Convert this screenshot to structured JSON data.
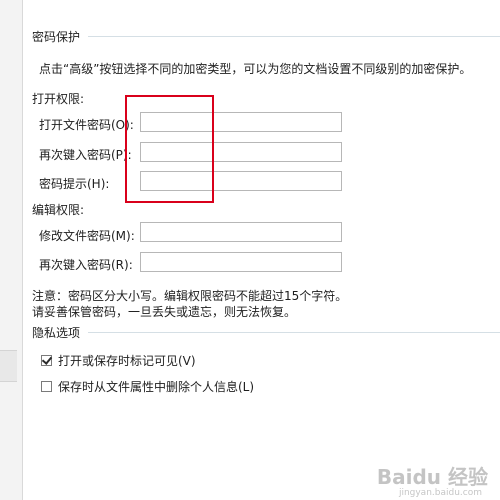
{
  "encryption_section": {
    "title": "密码保护",
    "description": "点击“高级”按钮选择不同的加密类型，可以为您的文档设置不同级别的加密保护。"
  },
  "open_permission": {
    "label": "打开权限:",
    "fields": [
      {
        "label": "打开文件密码(O):",
        "value": ""
      },
      {
        "label": "再次键入密码(P):",
        "value": ""
      },
      {
        "label": "密码提示(H):",
        "value": ""
      }
    ]
  },
  "edit_permission": {
    "label": "编辑权限:",
    "fields": [
      {
        "label": "修改文件密码(M):",
        "value": ""
      },
      {
        "label": "再次键入密码(R):",
        "value": ""
      }
    ]
  },
  "notes": [
    "注意：密码区分大小写。编辑权限密码不能超过15个字符。",
    "请妥善保管密码，一旦丢失或遗忘，则无法恢复。"
  ],
  "privacy_section": {
    "title": "隐私选项",
    "options": [
      {
        "label": "打开或保存时标记可见(V)",
        "checked": true
      },
      {
        "label": "保存时从文件属性中删除个人信息(L)",
        "checked": false
      }
    ]
  },
  "watermark": {
    "logo_text": "Baidu 经验",
    "sub_text": "jingyan.baidu.com"
  },
  "colors": {
    "highlight": "#d9001b",
    "section_line": "#d5dfe5"
  }
}
